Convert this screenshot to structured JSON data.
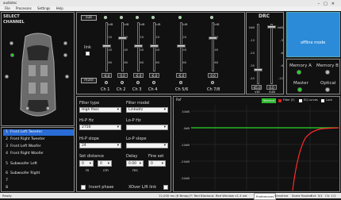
{
  "window": {
    "title": "audiotec"
  },
  "menu": [
    "File",
    "Processes",
    "Settings",
    "Help"
  ],
  "select_channel": {
    "line1": "SELECT",
    "line2": "CHANNEL"
  },
  "channels": [
    {
      "num": "1",
      "label": "Front Left Tweeter",
      "active": true
    },
    {
      "num": "2",
      "label": "Front Right Tweeter"
    },
    {
      "num": "3",
      "label": "Front Left Woofer"
    },
    {
      "num": "4",
      "label": "Front Right Woofer"
    },
    {
      "num": "5",
      "label": "Subwoofer Left"
    },
    {
      "num": "6",
      "label": "Subwoofer Right"
    },
    {
      "num": "7",
      "label": ""
    },
    {
      "num": "8",
      "label": ""
    }
  ],
  "mixer": {
    "sub_label": "sub",
    "link_label": "link",
    "mute_label": "mute",
    "scale": [
      "0dB",
      "-20",
      "-40",
      "-60",
      "-80"
    ],
    "values": [
      "-6.0",
      "0.0",
      "-6.0",
      "-6.0",
      "-6.0",
      "0.0"
    ],
    "names": [
      "Ch 1",
      "Ch 2",
      "Ch 3",
      "Ch 4",
      "Ch 5/6",
      "Ch 7/8"
    ]
  },
  "drc": {
    "title": "DRC",
    "scale": [
      "0dB",
      "-10",
      "-20",
      "-30",
      "-40"
    ],
    "sub_scale": [
      "0dB",
      "-3",
      "-6",
      "-9",
      "-12"
    ],
    "vol_value": "-45.0",
    "sub_value": "0.0",
    "vol_label": "vol",
    "sub_label": "sub"
  },
  "offline_mode": "offline mode",
  "memory": {
    "a": "Memory A",
    "b": "Memory B",
    "master": "Master",
    "optical": "Optical"
  },
  "filter": {
    "type_label": "Filter type",
    "type_value": "High Pass",
    "model_label": "Filter model",
    "model_value": "Linkwitz",
    "hip_hz_label": "Hi-P Hz",
    "hip_hz_value": "2750",
    "lop_hz_label": "Lo-P Hz",
    "lop_hz_value": "",
    "hip_slope_label": "Hi-P slope",
    "hip_slope_value": "24",
    "lop_slope_label": "Lo-P slope",
    "lop_slope_value": "",
    "set_distance_label": "Set distance",
    "delay_label": "Delay",
    "fine_set_label": "Fine set",
    "dist1": "0",
    "dist2": "0",
    "delay_value": "0.00",
    "fine_value": "0",
    "unit_m": "m",
    "unit_cm": "cm",
    "unit_ms": "ms",
    "invert_label": "Invert phase",
    "xover_label": "XOver L/R link"
  },
  "graph": {
    "tag": "Ref",
    "btn": "Readout",
    "cb1": "Filter (F)",
    "cb2": "EQ curves",
    "cb3": "Lock",
    "yticks": [
      "10dB",
      "0dB",
      "-10dB",
      "-20dB",
      "-30dB"
    ],
    "chart_data": {
      "type": "line",
      "series": [
        {
          "name": "Filter",
          "color": "#ff2a2a"
        },
        {
          "name": "EQ",
          "color": "#29d629"
        }
      ]
    }
  },
  "status": {
    "left": "Ready",
    "mid": "12,000 ms (6 Bmap) F: Red Blackout, Red Window v1.4 wd",
    "s1": "Preferences",
    "s2": "Sensitive",
    "s3": "Some Routed",
    "s4": "Ext: 5/1",
    "s5": "Ch: 1/1"
  }
}
